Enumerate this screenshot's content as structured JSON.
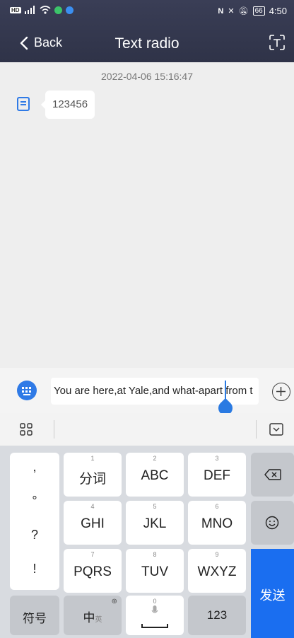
{
  "status_bar": {
    "time": "4:50",
    "battery": "66",
    "hd": "HD"
  },
  "header": {
    "back_label": "Back",
    "title": "Text radio"
  },
  "chat": {
    "timestamp": "2022-04-06 15:16:47",
    "messages": [
      {
        "text": "123456"
      }
    ]
  },
  "input": {
    "value": "You are here,at Yale,and what-apart from t"
  },
  "keyboard": {
    "symbol_keys": [
      ",",
      "°",
      "?",
      "!"
    ],
    "rows": [
      [
        {
          "num": "1",
          "label": "分词"
        },
        {
          "num": "2",
          "label": "ABC"
        },
        {
          "num": "3",
          "label": "DEF"
        }
      ],
      [
        {
          "num": "4",
          "label": "GHI"
        },
        {
          "num": "5",
          "label": "JKL"
        },
        {
          "num": "6",
          "label": "MNO"
        }
      ],
      [
        {
          "num": "7",
          "label": "PQRS"
        },
        {
          "num": "8",
          "label": "TUV"
        },
        {
          "num": "9",
          "label": "WXYZ"
        }
      ]
    ],
    "symbols_label": "符号",
    "lang_label": "中",
    "lang_sub": "英",
    "space_num": "0",
    "numbers_label": "123",
    "send_label": "发送"
  }
}
